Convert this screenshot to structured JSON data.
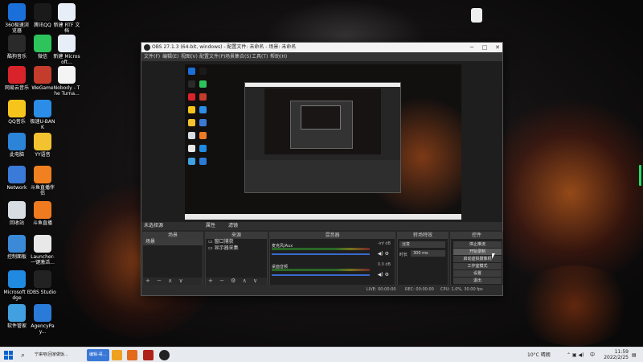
{
  "desktop": {
    "icons": [
      {
        "label": "360极速浏览器",
        "color": "#1a6fd8"
      },
      {
        "label": "腾讯QQ",
        "color": "#1a1a1a"
      },
      {
        "label": "新建 RTF 文档",
        "color": "#e8eef8"
      },
      {
        "label": "酷狗音乐",
        "color": "#2a2a2a"
      },
      {
        "label": "微信",
        "color": "#2dc45c"
      },
      {
        "label": "新建 Microsoft...",
        "color": "#e8eef8"
      },
      {
        "label": "网易云音乐",
        "color": "#d8232a"
      },
      {
        "label": "WeGame",
        "color": "#c33c2c"
      },
      {
        "label": "Nobody - The Turna...",
        "color": "#f4f4f4"
      },
      {
        "label": "QQ音乐",
        "color": "#f6c51b"
      },
      {
        "label": "极速U-BANK",
        "color": "#2b8de8"
      },
      {
        "label": "此电脑",
        "color": "#2b84d8"
      },
      {
        "label": "YY语音",
        "color": "#f2c230"
      },
      {
        "label": "Network",
        "color": "#3a7ad8"
      },
      {
        "label": "斗鱼直播伴侣",
        "color": "#f08020"
      },
      {
        "label": "回收站",
        "color": "#d8dde4"
      },
      {
        "label": "斗鱼直播",
        "color": "#f07a20"
      },
      {
        "label": "控制面板",
        "color": "#3a8ad8"
      },
      {
        "label": "Launcher-一键激活...",
        "color": "#e8e8e8"
      },
      {
        "label": "Microsoft Edge",
        "color": "#1f8ae0"
      },
      {
        "label": "OBS Studio",
        "color": "#222222"
      },
      {
        "label": "软件管家",
        "color": "#40a0e0"
      },
      {
        "label": "AgencyPay...",
        "color": "#2a7ad8"
      }
    ]
  },
  "obs": {
    "title": "OBS 27.1.3 (64-bit, windows) - 配置文件: 未命名 - 场景: 未命名",
    "win_min": "─",
    "win_max": "□",
    "win_close": "✕",
    "menu": [
      "文件(F)",
      "编辑(E)",
      "视图(V)",
      "配置文件(P)",
      "场景集合(S)",
      "工具(T)",
      "帮助(H)"
    ],
    "source_bar": {
      "no_source": "未选择源",
      "props": "属性",
      "filters": "滤镜"
    },
    "docks": {
      "scenes": {
        "title": "场景",
        "items": [
          "场景"
        ],
        "footer": "+ − ∧ ∨"
      },
      "sources": {
        "title": "来源",
        "items": [
          "窗口捕获",
          "显示器采集"
        ],
        "footer": "+ − ⚙ ∧ ∨"
      },
      "mixer": {
        "title": "混音器",
        "tracks": [
          {
            "name": "麦克风/Aux",
            "db": "-inf dB",
            "level": 0.0
          },
          {
            "name": "桌面音频",
            "db": "0.0 dB",
            "level": 0.0
          }
        ]
      },
      "transitions": {
        "title": "转场特效",
        "type": "淡变",
        "duration_label": "时长",
        "duration_value": "300 ms"
      },
      "controls": {
        "title": "控件",
        "buttons": [
          "停止推流",
          "开始录制",
          "启动虚拟摄像机",
          "工作室模式",
          "设置",
          "退出"
        ]
      }
    },
    "status": {
      "dropped": "LIVE: 00:00:00",
      "rec": "REC: 00:00:00",
      "cpu": "CPU: 1.0%, 30.00 fps"
    }
  },
  "taskbar": {
    "search_icon": "⌕",
    "app_label": "宁来吧(回家做饭...",
    "active_label": "编辑-哥...",
    "weather": "10°C 晴朗",
    "lang": "中",
    "time": "11:59",
    "date": "2022/2/25"
  }
}
